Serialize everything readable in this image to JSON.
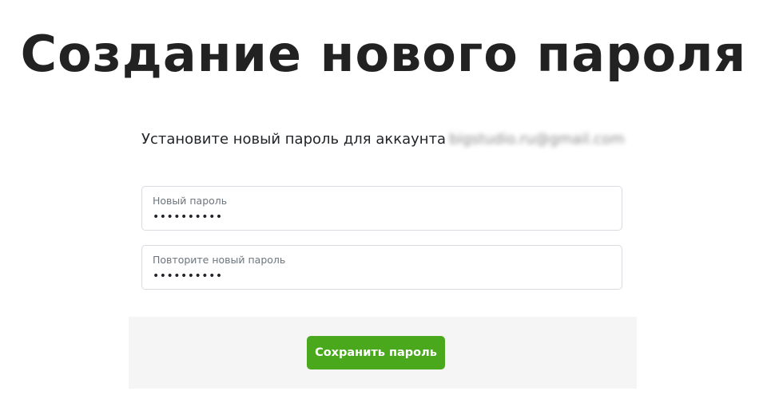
{
  "page": {
    "title": "Создание нового пароля"
  },
  "form": {
    "subtitle_text": "Установите новый пароль для аккаунта",
    "email": "bigstudio.ru@gmail.com",
    "new_password": {
      "label": "Новый пароль",
      "value": "••••••••••"
    },
    "repeat_password": {
      "label": "Повторите новый пароль",
      "value": "••••••••••"
    },
    "save_label": "Сохранить пароль"
  },
  "colors": {
    "accent": "#4aa81c",
    "panel_bg": "#f5f5f5",
    "border": "#d8dbe0"
  }
}
